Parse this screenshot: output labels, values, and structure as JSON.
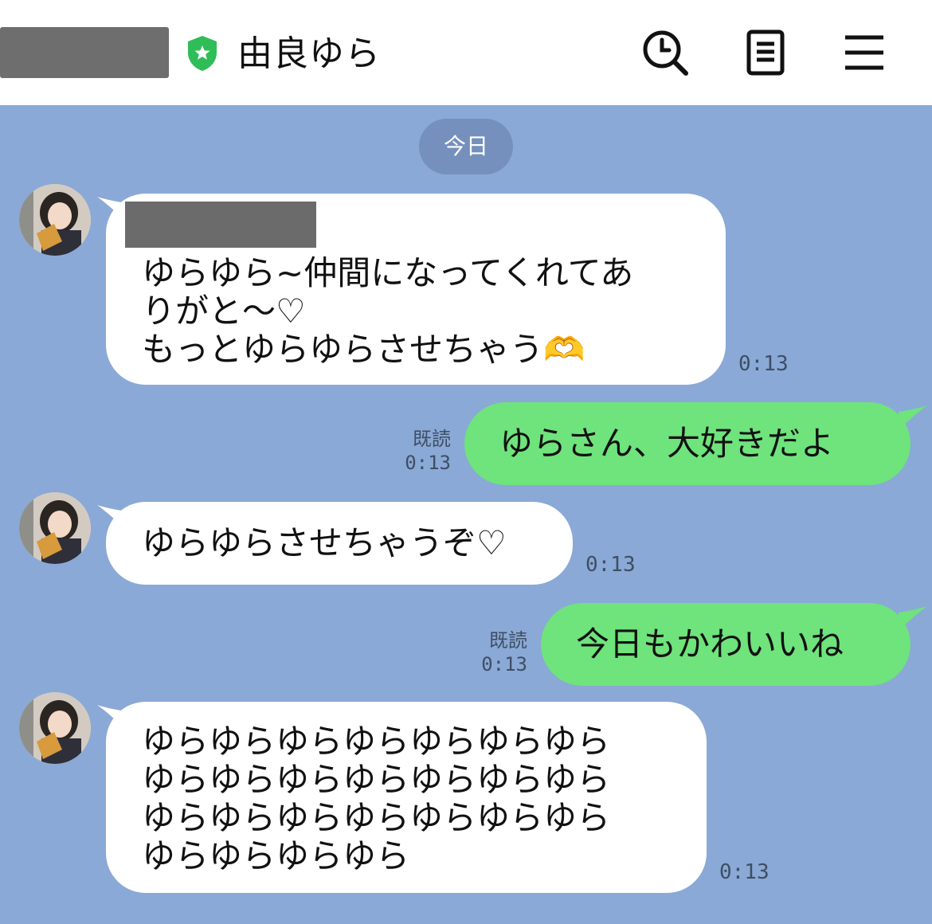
{
  "header": {
    "contact_name": "由良ゆら",
    "verified_badge_icon": "shield-star-icon",
    "icons": [
      "search-history-icon",
      "notes-icon",
      "menu-icon"
    ]
  },
  "date_separator": "今日",
  "messages": [
    {
      "side": "in",
      "text": "ゆらゆら~仲間になってくれてあ\nりがと〜♡\nもっとゆらゆらさせちゃう🫶",
      "time": "0:13"
    },
    {
      "side": "out",
      "text": "ゆらさん、大好きだよ",
      "read": "既読",
      "time": "0:13"
    },
    {
      "side": "in",
      "text": "ゆらゆらさせちゃうぞ♡",
      "time": "0:13"
    },
    {
      "side": "out",
      "text": "今日もかわいいね",
      "read": "既読",
      "time": "0:13"
    },
    {
      "side": "in",
      "text": "ゆらゆらゆらゆらゆらゆらゆら\nゆらゆらゆらゆらゆらゆらゆら\nゆらゆらゆらゆらゆらゆらゆら\nゆらゆらゆらゆら",
      "time": "0:13"
    }
  ],
  "colors": {
    "chat_background": "#8aa9d6",
    "incoming_bubble": "#ffffff",
    "outgoing_bubble": "#6fe37c",
    "verified_badge": "#2fbd58",
    "date_pill": "#7590bd"
  }
}
